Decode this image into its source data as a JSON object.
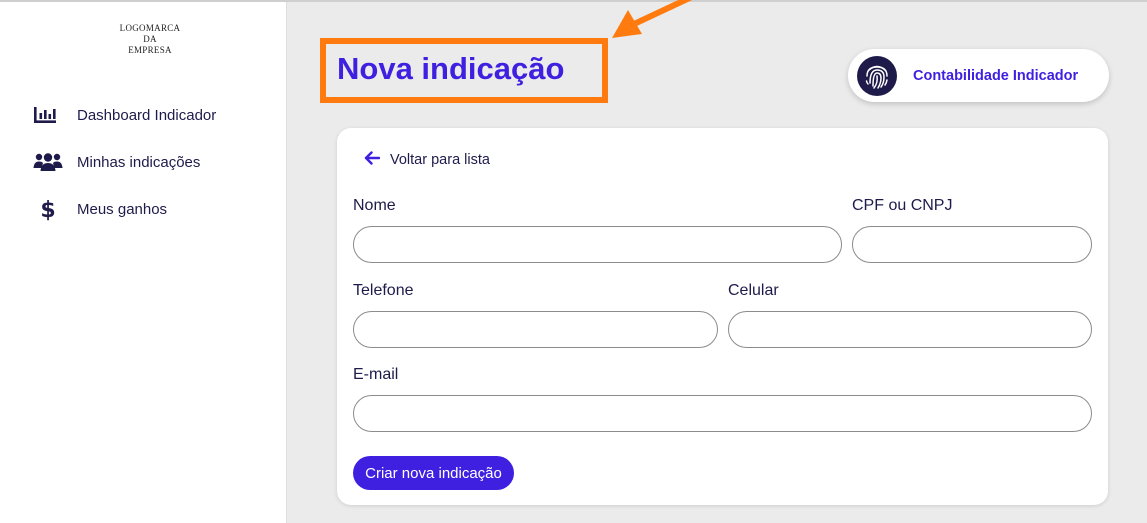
{
  "sidebar": {
    "logo": [
      "LOGOMARCA",
      "DA",
      "EMPRESA"
    ],
    "items": [
      {
        "label": "Dashboard Indicador",
        "icon": "chart-bar-icon"
      },
      {
        "label": "Minhas indicações",
        "icon": "users-icon"
      },
      {
        "label": "Meus ganhos",
        "icon": "dollar-icon"
      }
    ]
  },
  "header": {
    "title": "Nova indicação",
    "user": {
      "name": "Contabilidade Indicador",
      "avatar_icon": "fingerprint-icon"
    },
    "annotation": {
      "box_color": "#ff7b0f",
      "arrow_color": "#ff7b0f"
    }
  },
  "form": {
    "back_label": "Voltar para lista",
    "fields": {
      "nome": {
        "label": "Nome",
        "value": ""
      },
      "cpf_cnpj": {
        "label": "CPF ou CNPJ",
        "value": ""
      },
      "telefone": {
        "label": "Telefone",
        "value": ""
      },
      "celular": {
        "label": "Celular",
        "value": ""
      },
      "email": {
        "label": "E-mail",
        "value": ""
      }
    },
    "submit_label": "Criar nova indicação"
  },
  "colors": {
    "accent": "#3f1fe0",
    "nav_text": "#1e1b4b",
    "background": "#ebebeb"
  }
}
